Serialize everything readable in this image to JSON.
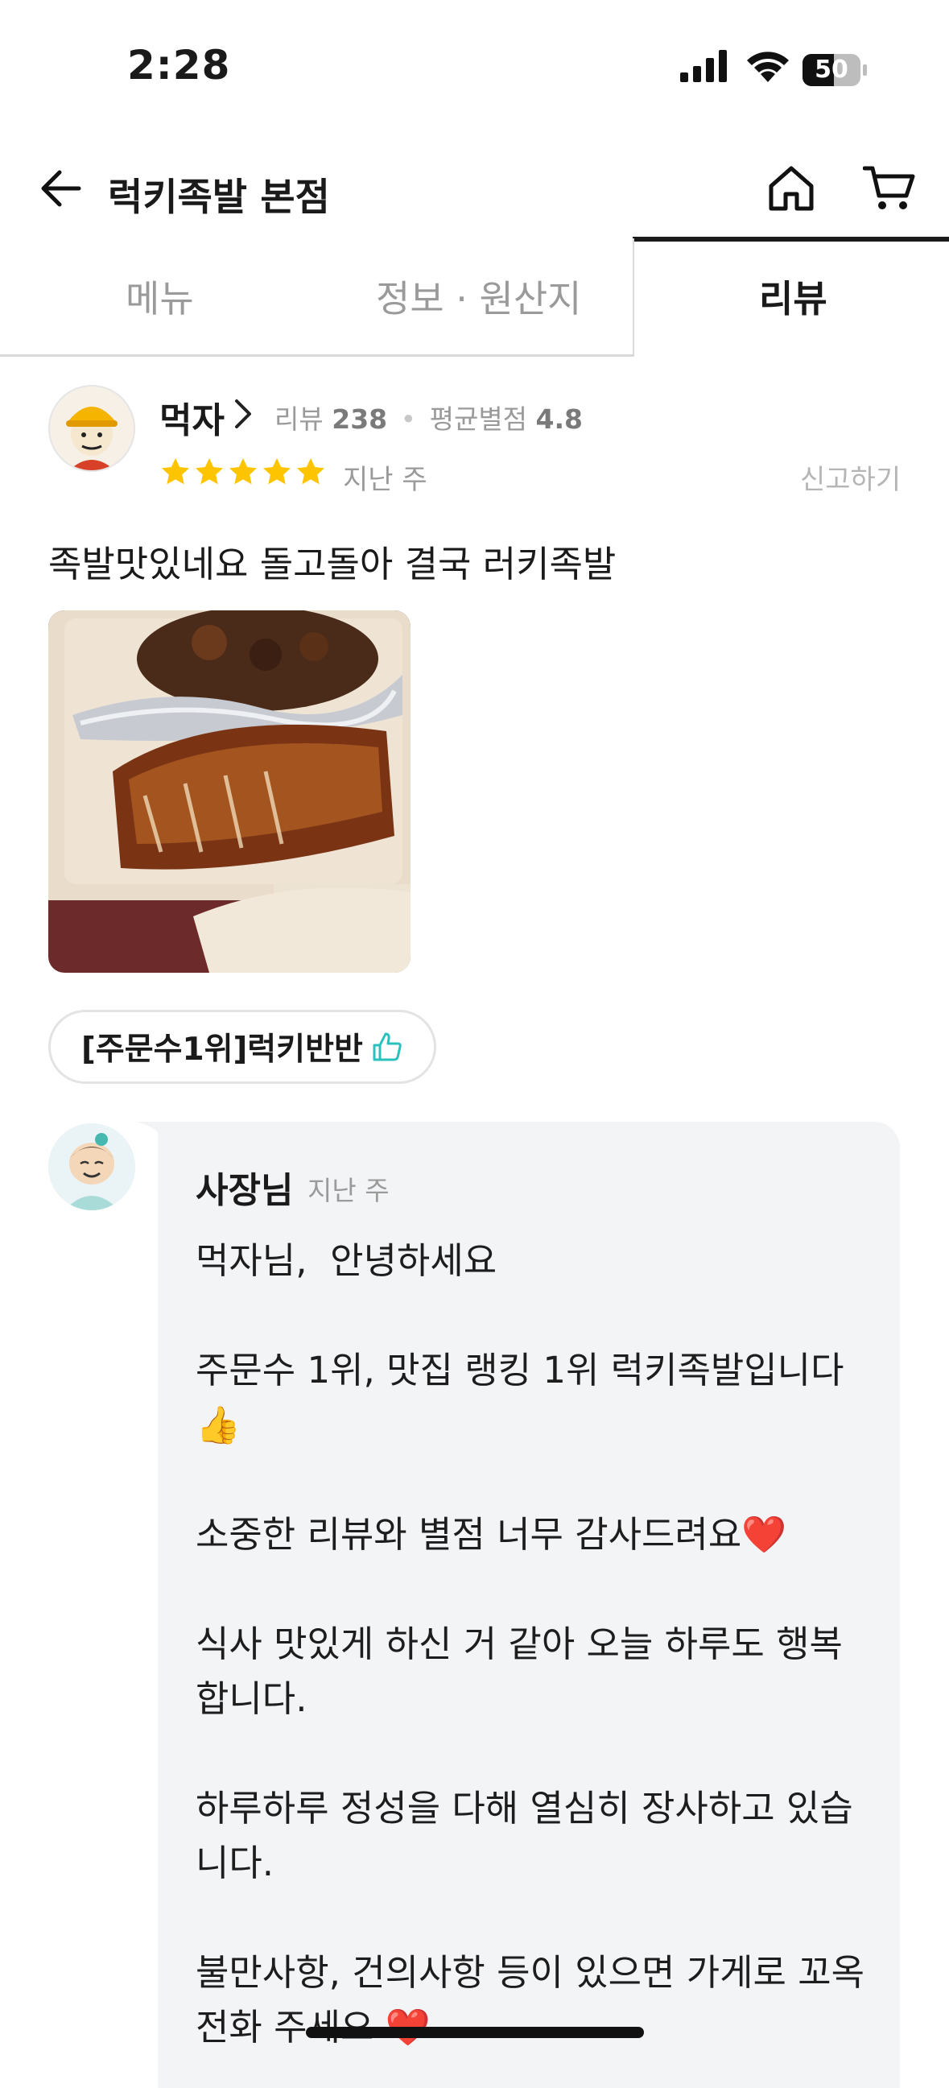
{
  "status_bar": {
    "time": "2:28",
    "battery": "50"
  },
  "header": {
    "title": "럭키족발 본점",
    "back_icon": "arrow-left-icon",
    "home_icon": "home-icon",
    "cart_icon": "cart-icon"
  },
  "tabs": [
    {
      "label": "메뉴",
      "active": false
    },
    {
      "label": "정보 · 원산지",
      "active": false
    },
    {
      "label": "리뷰",
      "active": true
    }
  ],
  "review": {
    "nickname": "먹자",
    "review_count_label": "리뷰",
    "review_count": "238",
    "avg_rating_label": "평균별점",
    "avg_rating": "4.8",
    "rating": 5,
    "time": "지난 주",
    "report": "신고하기",
    "text": "족발맛있네요 돌고돌아 결국 러키족발",
    "menu_chip": "[주문수1위]럭키반반"
  },
  "owner_reply": {
    "name": "사장님",
    "time": "지난 주",
    "text": "먹자님,  안녕하세요\n\n주문수 1위, 맛집 랭킹 1위 럭키족발입니다\n👍\n\n소중한 리뷰와 별점 너무 감사드려요❤️\n\n식사 맛있게 하신 거 같아 오늘 하루도 행복\n합니다.\n\n하루하루 정성을 다해 열심히 장사하고 있습\n니다.\n\n불만사항, 건의사항 등이 있으면 가게로 꼬옥\n전화 주세요 ❤️"
  },
  "colors": {
    "star": "#FFC400",
    "accent_thumb": "#2AC1BC",
    "bubble_bg": "#F3F4F6"
  }
}
